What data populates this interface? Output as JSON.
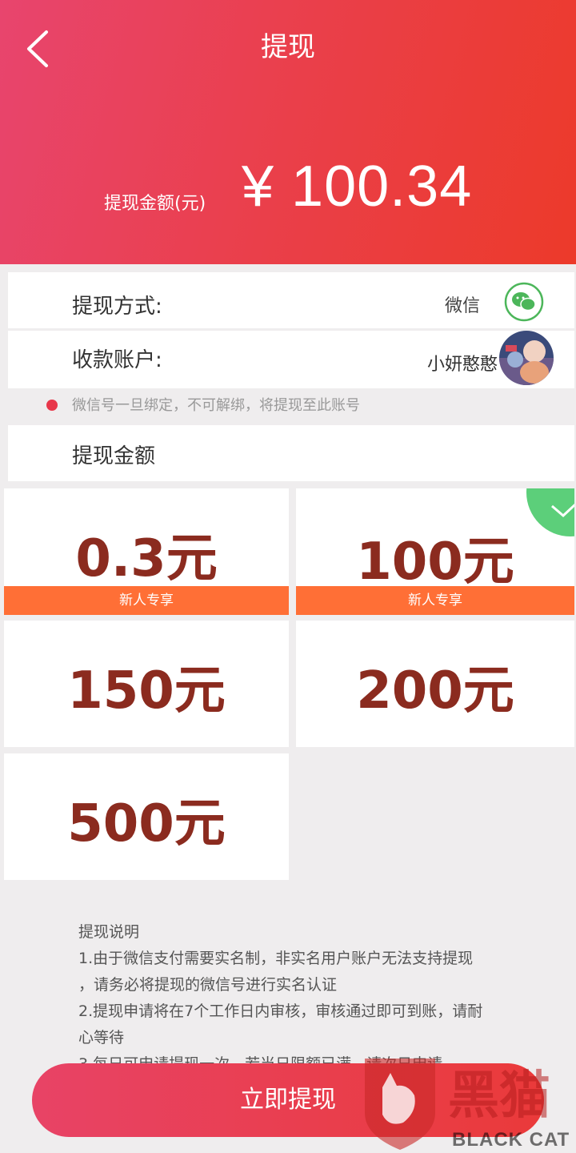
{
  "header": {
    "title": "提现",
    "amount_label": "提现金额(元)",
    "amount_value": "¥ 100.34",
    "gradient": [
      "#e8456e",
      "#ec3a2a"
    ]
  },
  "method": {
    "label": "提现方式:",
    "value": "微信",
    "icon": "wechat-icon"
  },
  "account": {
    "label": "收款账户:",
    "name": "小妍憨憨",
    "avatar": "avatar"
  },
  "notice": "微信号一旦绑定，不可解绑，将提现至此账号",
  "amount_section": {
    "label": "提现金额"
  },
  "options": [
    {
      "value": "0.3元",
      "tag": "新人专享",
      "selected": false
    },
    {
      "value": "100元",
      "tag": "新人专享",
      "selected": true
    },
    {
      "value": "150元",
      "tag": "",
      "selected": false
    },
    {
      "value": "200元",
      "tag": "",
      "selected": false
    },
    {
      "value": "500元",
      "tag": "",
      "selected": false
    }
  ],
  "explain": {
    "title": "提现说明",
    "line1": "1.由于微信支付需要实名制，非实名用户账户无法支持提现",
    "line2": "，请务必将提现的微信号进行实名认证",
    "line3": "2.提现申请将在7个工作日内审核，审核通过即可到账，请耐",
    "line4": "心等待",
    "line5": "3.每日可申请提现一次，若当日限额已满，请次日申请"
  },
  "submit_label": "立即提现",
  "watermark": {
    "brand": "黑猫",
    "text": "BLACK CAT"
  },
  "colors": {
    "accent": "#ea3f4a",
    "card_value": "#8b2b1f",
    "tag": "#ff6f36",
    "check": "#5ccf7a"
  }
}
